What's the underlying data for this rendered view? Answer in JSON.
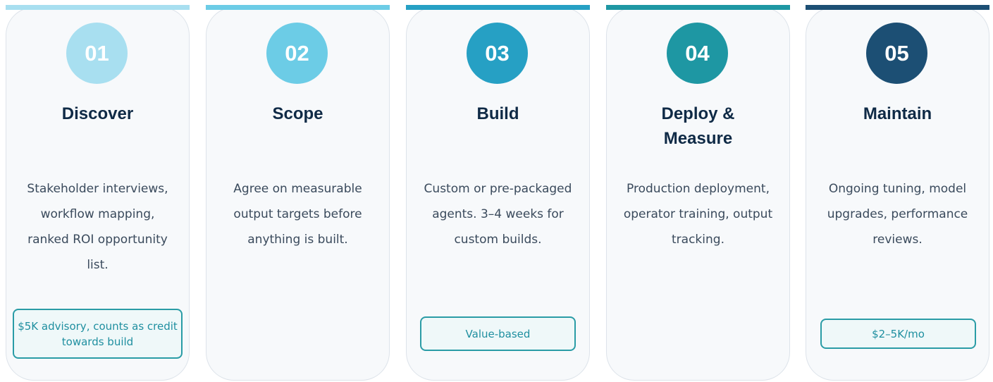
{
  "steps": [
    {
      "number": "01",
      "title": "Discover",
      "description": "Stakeholder interviews, workflow mapping, ranked ROI opportunity list.",
      "badge": "$5K advisory, counts as credit towards build",
      "color": "#a8dff0"
    },
    {
      "number": "02",
      "title": "Scope",
      "description": "Agree on measurable output targets before anything is built.",
      "badge": "",
      "color": "#6ccce6"
    },
    {
      "number": "03",
      "title": "Build",
      "description": "Custom or pre-packaged agents. 3–4 weeks for custom builds.",
      "badge": "Value-based",
      "color": "#26a0c4"
    },
    {
      "number": "04",
      "title": "Deploy & Measure",
      "description": "Production deployment, operator training, output tracking.",
      "badge": "",
      "color": "#1e97a3"
    },
    {
      "number": "05",
      "title": "Maintain",
      "description": "Ongoing tuning, model upgrades, performance reviews.",
      "badge": "$2–5K/mo",
      "color": "#1c4f74"
    }
  ]
}
